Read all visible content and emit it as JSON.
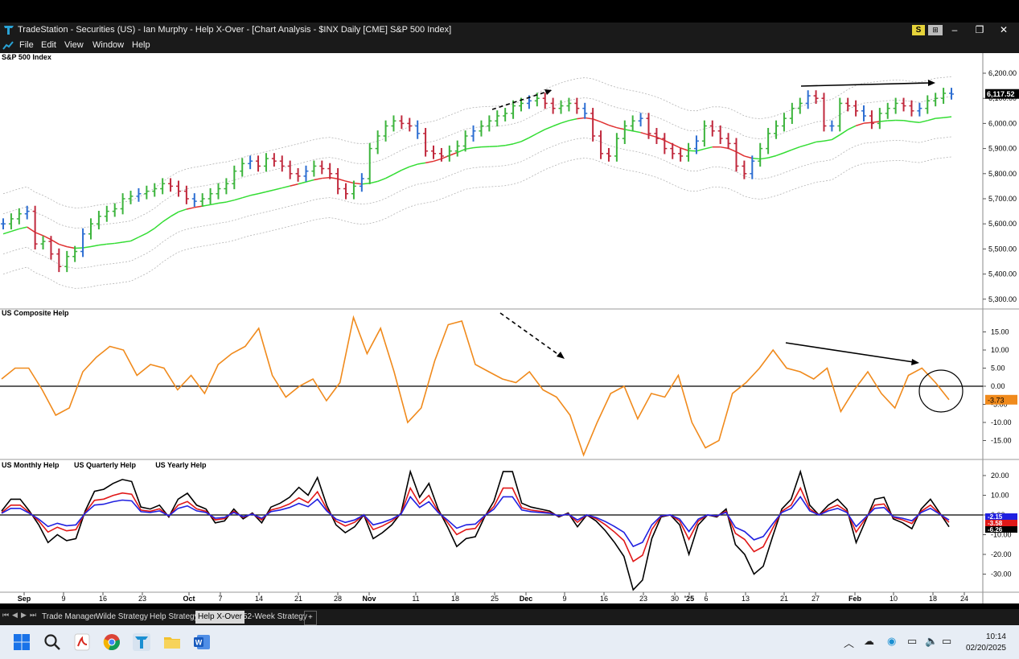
{
  "window": {
    "title": "TradeStation  -  Securities (US)  -  Ian Murphy  -  Help X-Over  -  [Chart Analysis - $INX Daily [CME] S&P 500 Index]",
    "badge_s": "S",
    "badge_g": "⊞"
  },
  "menu": [
    "File",
    "Edit",
    "View",
    "Window",
    "Help"
  ],
  "chart": {
    "price_pane_title": "S&P 500 Index",
    "price_axis": [
      "6,200.00",
      "6,100.00",
      "6,000.00",
      "5,900.00",
      "5,800.00",
      "5,700.00",
      "5,600.00",
      "5,500.00",
      "5,400.00",
      "5,300.00"
    ],
    "last_price": "6,117.52",
    "composite_title": "US Composite Help",
    "composite_axis": [
      "15.00",
      "10.00",
      "5.00",
      "0.00",
      "-5.00",
      "-10.00",
      "-15.00"
    ],
    "composite_last": "-3.73",
    "lower_titles": [
      "US Monthly Help",
      "US Quarterly Help",
      "US Yearly Help"
    ],
    "lower_axis": [
      "20.00",
      "10.00",
      "0.00",
      "-10.00",
      "-20.00",
      "-30.00"
    ],
    "lower_last": [
      "-2.15",
      "-3.58",
      "-6.26"
    ],
    "date_labels": [
      {
        "t": "Sep",
        "bold": true
      },
      {
        "t": "9"
      },
      {
        "t": "16"
      },
      {
        "t": "23"
      },
      {
        "t": "Oct",
        "bold": true
      },
      {
        "t": "7"
      },
      {
        "t": "14"
      },
      {
        "t": "21"
      },
      {
        "t": "28"
      },
      {
        "t": "Nov",
        "bold": true
      },
      {
        "t": "11"
      },
      {
        "t": "18"
      },
      {
        "t": "25"
      },
      {
        "t": "Dec",
        "bold": true
      },
      {
        "t": "9"
      },
      {
        "t": "16"
      },
      {
        "t": "23"
      },
      {
        "t": "30"
      },
      {
        "t": "'25",
        "bold": true
      },
      {
        "t": "6"
      },
      {
        "t": "13"
      },
      {
        "t": "21"
      },
      {
        "t": "27"
      },
      {
        "t": "Feb",
        "bold": true
      },
      {
        "t": "10"
      },
      {
        "t": "18"
      },
      {
        "t": "24"
      }
    ],
    "colors": {
      "up_bar": "#3cb43c",
      "down_bar": "#c0283c",
      "neutral_bar": "#2d6ed2",
      "ma_up": "#33dd33",
      "ma_down": "#e03030",
      "composite": "#f08a1c",
      "monthly": "#2020e0",
      "quarterly": "#e01818",
      "yearly": "#000000",
      "envelope": "#b4b4b4"
    }
  },
  "chart_data": {
    "type": "line",
    "price_series": {
      "name": "$INX Daily",
      "x": [
        "Sep 9",
        "Sep 16",
        "Sep 23",
        "Oct 7",
        "Oct 14",
        "Oct 21",
        "Oct 28",
        "Nov 11",
        "Nov 18",
        "Nov 25",
        "Dec 9",
        "Dec 16",
        "Dec 23",
        "Dec 30",
        "Jan 6",
        "Jan 13",
        "Jan 21",
        "Jan 27",
        "Feb 10",
        "Feb 18"
      ],
      "close": [
        5470,
        5630,
        5720,
        5700,
        5860,
        5850,
        5840,
        6010,
        5900,
        6020,
        6050,
        5880,
        5990,
        5900,
        5950,
        5820,
        6100,
        6060,
        6080,
        6117.52
      ]
    },
    "composite": {
      "name": "US Composite Help",
      "values": [
        2,
        5,
        5,
        -1,
        -8,
        -6,
        4,
        8,
        11,
        10,
        3,
        6,
        5,
        -1,
        3,
        -2,
        6,
        9,
        11,
        16,
        3,
        -3,
        0,
        2,
        -4,
        1,
        19,
        9,
        16,
        4,
        -10,
        -6,
        7,
        17,
        18,
        6,
        4,
        2,
        1,
        4,
        -1,
        -3,
        -8,
        -19,
        -10,
        -2,
        0,
        -9,
        -2,
        -3,
        3,
        -10,
        -17,
        -15,
        -2,
        1,
        5,
        10,
        5,
        4,
        2,
        5,
        -7,
        -1,
        4,
        -2,
        -6,
        3,
        5,
        1,
        -3.73
      ],
      "ylim": [
        -20,
        20
      ]
    },
    "lower": [
      {
        "name": "US Monthly Help",
        "last": -2.15
      },
      {
        "name": "US Quarterly Help",
        "last": -3.58
      },
      {
        "name": "US Yearly Help",
        "last": -6.26
      }
    ]
  },
  "tabs": [
    "Trade Manager",
    "Wilde Strategy",
    "Help Strategy",
    "Help X-Over",
    "52-Week Strategy"
  ],
  "active_tab": "Help X-Over",
  "taskbar": {
    "time": "10:14",
    "date": "02/20/2025"
  }
}
